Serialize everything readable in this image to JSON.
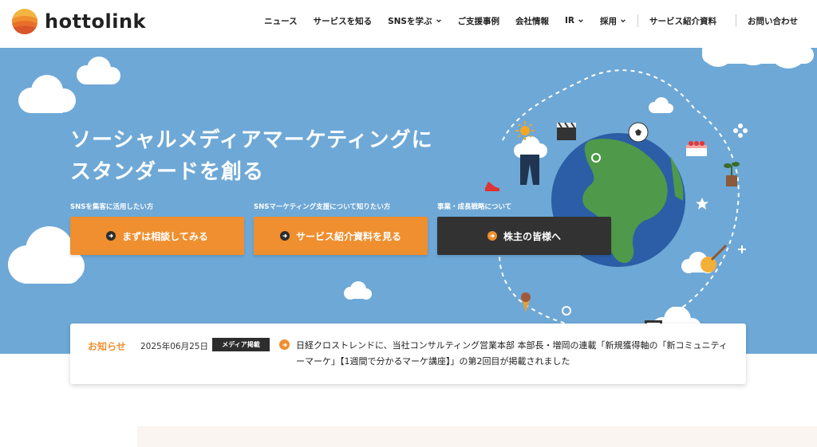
{
  "brand": {
    "name": "hottolink"
  },
  "nav": {
    "items": [
      {
        "label": "ニュース",
        "dropdown": false
      },
      {
        "label": "サービスを知る",
        "dropdown": false
      },
      {
        "label": "SNSを学ぶ",
        "dropdown": true
      },
      {
        "label": "ご支援事例",
        "dropdown": false
      },
      {
        "label": "会社情報",
        "dropdown": false
      },
      {
        "label": "IR",
        "dropdown": true
      },
      {
        "label": "採用",
        "dropdown": true
      }
    ],
    "docs": "サービス紹介資料",
    "contact": "お問い合わせ"
  },
  "hero": {
    "title": "ソーシャルメディアマーケティングに\nスタンダードを創る",
    "ctas": [
      {
        "label": "SNSを集客に活用したい方",
        "button": "まずは相談してみる",
        "style": "orange"
      },
      {
        "label": "SNSマーケティング支援について知りたい方",
        "button": "サービス紹介資料を見る",
        "style": "orange"
      },
      {
        "label": "事業・成長戦略について",
        "button": "株主の皆様へ",
        "style": "dark"
      }
    ]
  },
  "news": {
    "label": "お知らせ",
    "date": "2025年06月25日",
    "tag": "メディア掲載",
    "text": "日経クロストレンドに、当社コンサルティング営業本部 本部長・増岡の連載「新規獲得軸の「新コミュニティーマーケ」【1週間で分かるマーケ講座】」の第2回目が掲載されました"
  },
  "colors": {
    "hero_bg": "#6ea8d6",
    "accent_orange": "#ef8f2f",
    "dark_button": "#323232"
  }
}
